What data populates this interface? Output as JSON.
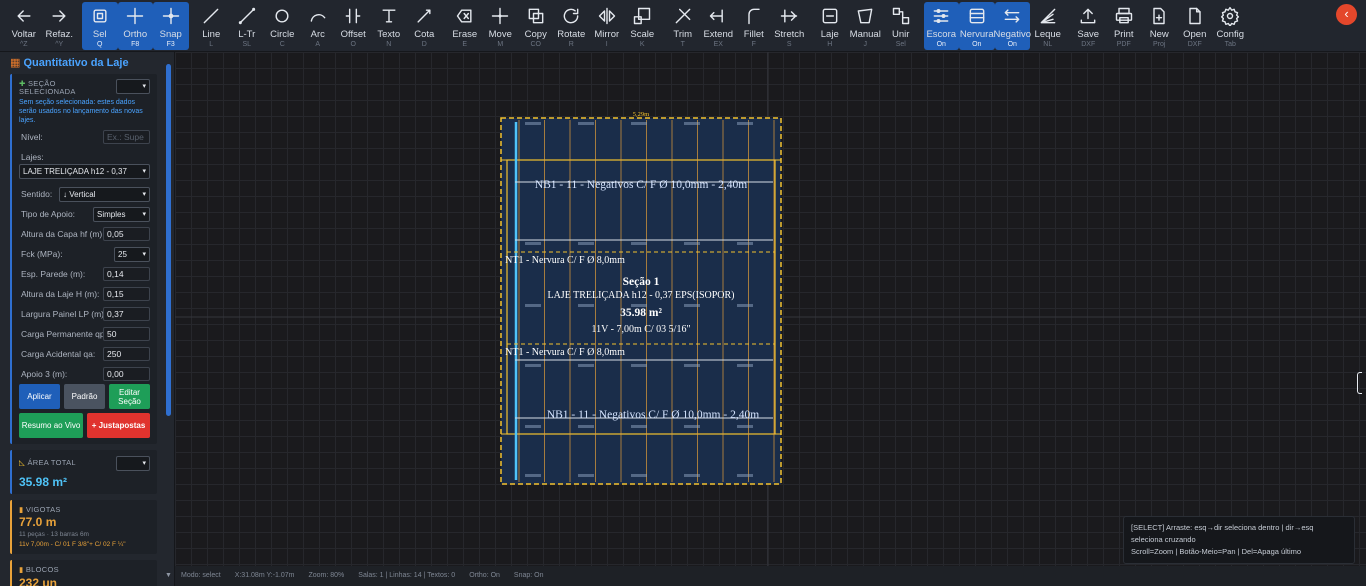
{
  "toolbar": {
    "buttons": [
      {
        "label": "Voltar",
        "key": "^Z",
        "icon": "arrow-left-icon",
        "active": false
      },
      {
        "label": "Refaz.",
        "key": "^Y",
        "icon": "arrow-right-icon",
        "active": false
      },
      {
        "label": "Sel",
        "key": "Q",
        "icon": "select-icon",
        "active": true
      },
      {
        "label": "Ortho",
        "key": "F8",
        "icon": "ortho-icon",
        "active": true
      },
      {
        "label": "Snap",
        "key": "F3",
        "icon": "snap-icon",
        "active": true
      },
      {
        "label": "Line",
        "key": "L",
        "icon": "line-icon",
        "active": false
      },
      {
        "label": "L-Tr",
        "key": "SL",
        "icon": "line-trace-icon",
        "active": false
      },
      {
        "label": "Circle",
        "key": "C",
        "icon": "circle-icon",
        "active": false
      },
      {
        "label": "Arc",
        "key": "A",
        "icon": "arc-icon",
        "active": false
      },
      {
        "label": "Offset",
        "key": "O",
        "icon": "offset-icon",
        "active": false
      },
      {
        "label": "Texto",
        "key": "N",
        "icon": "text-icon",
        "active": false
      },
      {
        "label": "Cota",
        "key": "D",
        "icon": "dimension-icon",
        "active": false
      },
      {
        "label": "Erase",
        "key": "E",
        "icon": "erase-icon",
        "active": false
      },
      {
        "label": "Move",
        "key": "M",
        "icon": "move-icon",
        "active": false
      },
      {
        "label": "Copy",
        "key": "CO",
        "icon": "copy-icon",
        "active": false
      },
      {
        "label": "Rotate",
        "key": "R",
        "icon": "rotate-icon",
        "active": false
      },
      {
        "label": "Mirror",
        "key": "I",
        "icon": "mirror-icon",
        "active": false
      },
      {
        "label": "Scale",
        "key": "K",
        "icon": "scale-icon",
        "active": false
      },
      {
        "label": "Trim",
        "key": "T",
        "icon": "trim-icon",
        "active": false
      },
      {
        "label": "Extend",
        "key": "EX",
        "icon": "extend-icon",
        "active": false
      },
      {
        "label": "Fillet",
        "key": "F",
        "icon": "fillet-icon",
        "active": false
      },
      {
        "label": "Stretch",
        "key": "S",
        "icon": "stretch-icon",
        "active": false
      },
      {
        "label": "Laje",
        "key": "H",
        "icon": "slab-icon",
        "active": false
      },
      {
        "label": "Manual",
        "key": "J",
        "icon": "manual-icon",
        "active": false
      },
      {
        "label": "Unir",
        "key": "Sel",
        "icon": "join-icon",
        "active": false
      },
      {
        "label": "Escora",
        "key": "On",
        "icon": "shoring-icon",
        "active": true
      },
      {
        "label": "Nervura",
        "key": "On",
        "icon": "rib-icon",
        "active": true
      },
      {
        "label": "Negativo",
        "key": "On",
        "icon": "negative-icon",
        "active": true
      },
      {
        "label": "Leque",
        "key": "NL",
        "icon": "fan-icon",
        "active": false
      },
      {
        "label": "Save",
        "key": "DXF",
        "icon": "save-icon",
        "active": false
      },
      {
        "label": "Print",
        "key": "PDF",
        "icon": "print-icon",
        "active": false
      },
      {
        "label": "New",
        "key": "Proj",
        "icon": "new-file-icon",
        "active": false
      },
      {
        "label": "Open",
        "key": "DXF",
        "icon": "open-file-icon",
        "active": false
      },
      {
        "label": "Config",
        "key": "Tab",
        "icon": "gear-icon",
        "active": false
      }
    ],
    "collapse_glyph": "‹"
  },
  "sidebar": {
    "title": "Quantitativo da Laje",
    "section": {
      "header": "SEÇÃO SELECIONADA",
      "dropdown": "▾",
      "note": "Sem seção selecionada: estes dados serão usados no lançamento das novas lajes.",
      "fields": [
        {
          "label": "Nível:",
          "value": "",
          "placeholder": "Ex.: Supe",
          "type": "input"
        },
        {
          "label": "Lajes:",
          "value": "",
          "type": "label"
        },
        {
          "label": "",
          "value": "LAJE TRELIÇADA h12 - 0,37",
          "type": "select-wide"
        },
        {
          "label": "Sentido:",
          "value": "↓ Vertical",
          "type": "select"
        },
        {
          "label": "Tipo de Apoio:",
          "value": "Simples",
          "type": "select"
        },
        {
          "label": "Altura da Capa hf (m):",
          "value": "0,05",
          "type": "input"
        },
        {
          "label": "Fck (MPa):",
          "value": "25",
          "type": "select"
        },
        {
          "label": "Esp. Parede (m):",
          "value": "0,14",
          "type": "input"
        },
        {
          "label": "Altura da Laje H (m):",
          "value": "0,15",
          "type": "input"
        },
        {
          "label": "Largura Painel LP (m):",
          "value": "0,37",
          "type": "input"
        },
        {
          "label": "Carga Permanente qp:",
          "value": "50",
          "type": "input"
        },
        {
          "label": "Carga Acidental qa:",
          "value": "250",
          "type": "input"
        },
        {
          "label": "Apoio 3 (m):",
          "value": "0,00",
          "type": "input"
        }
      ],
      "buttons": {
        "apply": "Aplicar",
        "default": "Padrão",
        "edit": "Editar Seção",
        "summary": "Resumo ao Vivo",
        "juxtaposed": "+ Justapostas"
      }
    },
    "area": {
      "header": "ÁREA TOTAL",
      "dropdown": "▾",
      "value": "35.98 m²"
    },
    "joists": {
      "header": "VIGOTAS",
      "value": "77.0 m",
      "detail": "11 peças · 13 barras 6m",
      "spec": "11v 7,00m - C/ 01 F 3/8\"+ C/ 02 F ¼\""
    },
    "blocks": {
      "header": "BLOCOS",
      "value": "232 un"
    }
  },
  "drawing": {
    "top_dim": "5,29m",
    "labels": {
      "section_title": "Seção 1",
      "slab_type": "LAJE TRELIÇADA h12 - 0,37 EPS(ISOPOR)",
      "area": "35.98 m²",
      "joists": "11V - 7,00m C/ 03 5/16\"",
      "neg_top": "NB1 - 11 - Negativos C/ F Ø 10,0mm - 2,40m",
      "neg_bottom": "NB1 - 11 - Negativos C/ F Ø 10,0mm - 2,40m",
      "rib_top": "NT1 - Nervura C/ F Ø 8,0mm",
      "rib_bottom": "NT1 - Nervura C/ F Ø 8,0mm"
    }
  },
  "hint": {
    "line1": "[SELECT] Arraste: esq→dir seleciona dentro | dir→esq seleciona cruzando",
    "line2": "Scroll=Zoom | Botão-Meio=Pan | Del=Apaga último"
  },
  "status": {
    "mode": "Modo: select",
    "coords": "X:31.08m Y:-1.07m",
    "zoom": "Zoom: 80%",
    "counts": "Salas: 1 | Linhas: 14 | Textos: 0",
    "ortho": "Ortho: On",
    "snap": "Snap: On"
  },
  "colors": {
    "accent": "#1f5fb9",
    "cyan": "#4fc3f7",
    "yellow": "#f2c12e",
    "slab_fill": "#1a2d4a",
    "orange": "#e8a23a",
    "green": "#1e9e58",
    "red": "#e0332e"
  }
}
